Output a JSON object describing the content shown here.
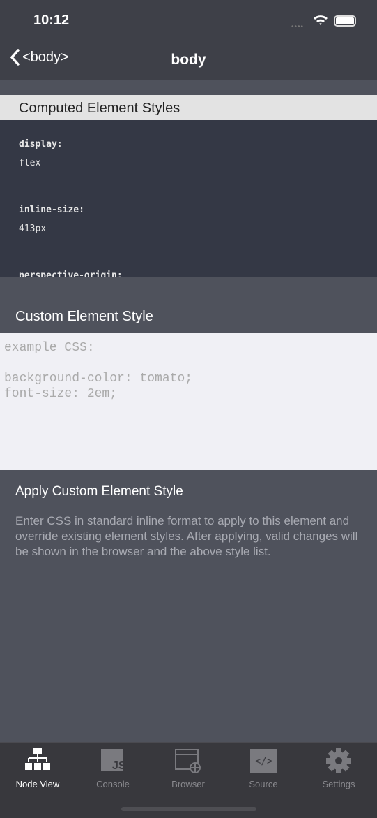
{
  "status_bar": {
    "time": "10:12"
  },
  "nav": {
    "back_label": "<body>",
    "title": "body"
  },
  "computed": {
    "header": "Computed Element Styles",
    "items": [
      {
        "key": "display:",
        "value": "flex"
      },
      {
        "key": "inline-size:",
        "value": "413px"
      },
      {
        "key": "perspective-origin:",
        "value": ""
      }
    ]
  },
  "custom": {
    "label": "Custom Element Style",
    "placeholder": "example CSS:\n\nbackground-color: tomato;\nfont-size: 2em;",
    "apply_label": "Apply Custom Element Style",
    "description": "Enter CSS in standard inline format to apply to this element and override existing element styles. After applying, valid changes will be shown in the browser and the above style list."
  },
  "tabs": [
    {
      "label": "Node View",
      "icon": "hierarchy-icon"
    },
    {
      "label": "Console",
      "icon": "js-icon"
    },
    {
      "label": "Browser",
      "icon": "browser-globe-icon"
    },
    {
      "label": "Source",
      "icon": "code-icon"
    },
    {
      "label": "Settings",
      "icon": "gear-icon"
    }
  ]
}
